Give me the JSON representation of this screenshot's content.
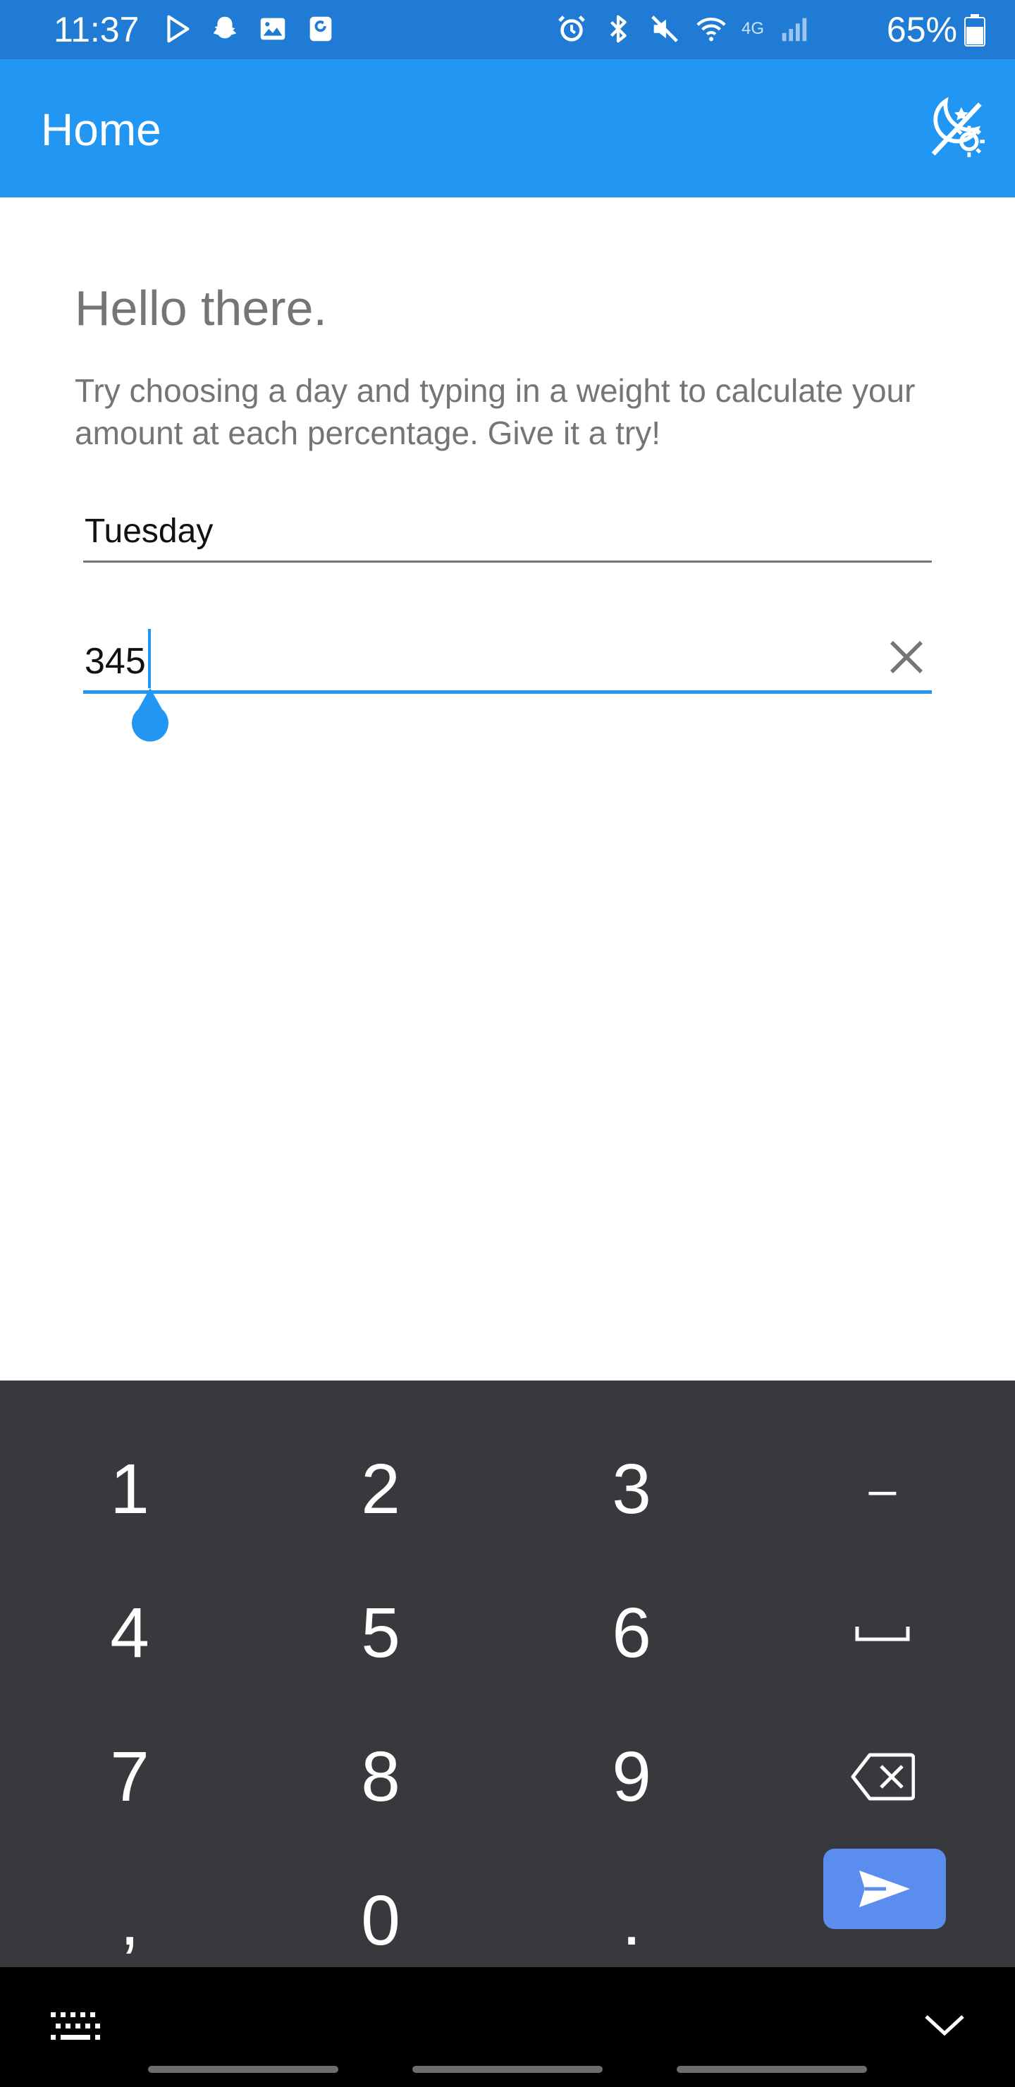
{
  "status_bar": {
    "time": "11:37",
    "battery_percent": "65%",
    "network_label": "4G",
    "background_color": "#1f7bd3",
    "left_icons": [
      "play-store-icon",
      "snapchat-icon",
      "gallery-icon",
      "app-notification-icon"
    ],
    "right_icons": [
      "alarm-icon",
      "bluetooth-icon",
      "mute-icon",
      "wifi-icon",
      "signal-icon"
    ]
  },
  "app_bar": {
    "title": "Home",
    "theme_toggle_icon": "day-night-toggle-icon",
    "background_color": "#2196f3"
  },
  "content": {
    "greeting": "Hello there.",
    "description": "Try choosing a day and typing in a weight to calculate your amount at each percentage. Give it a try!",
    "day_select": {
      "value": "Tuesday"
    },
    "weight_input": {
      "value": "345"
    },
    "accent_color": "#2196f3"
  },
  "keyboard": {
    "background_color": "#37393d",
    "send_key_color": "#5b8dee",
    "keys": [
      [
        "1",
        "2",
        "3",
        "–"
      ],
      [
        "4",
        "5",
        "6",
        "space"
      ],
      [
        "7",
        "8",
        "9",
        "backspace"
      ],
      [
        ",",
        "0",
        ".",
        "send"
      ]
    ],
    "labels": {
      "k1": "1",
      "k2": "2",
      "k3": "3",
      "minus": "–",
      "k4": "4",
      "k5": "5",
      "k6": "6",
      "k7": "7",
      "k8": "8",
      "k9": "9",
      "comma": ",",
      "k0": "0",
      "period": "."
    }
  },
  "nav_bar": {
    "left_icon": "keyboard-switch-icon",
    "right_icon": "hide-keyboard-chevron-icon"
  }
}
